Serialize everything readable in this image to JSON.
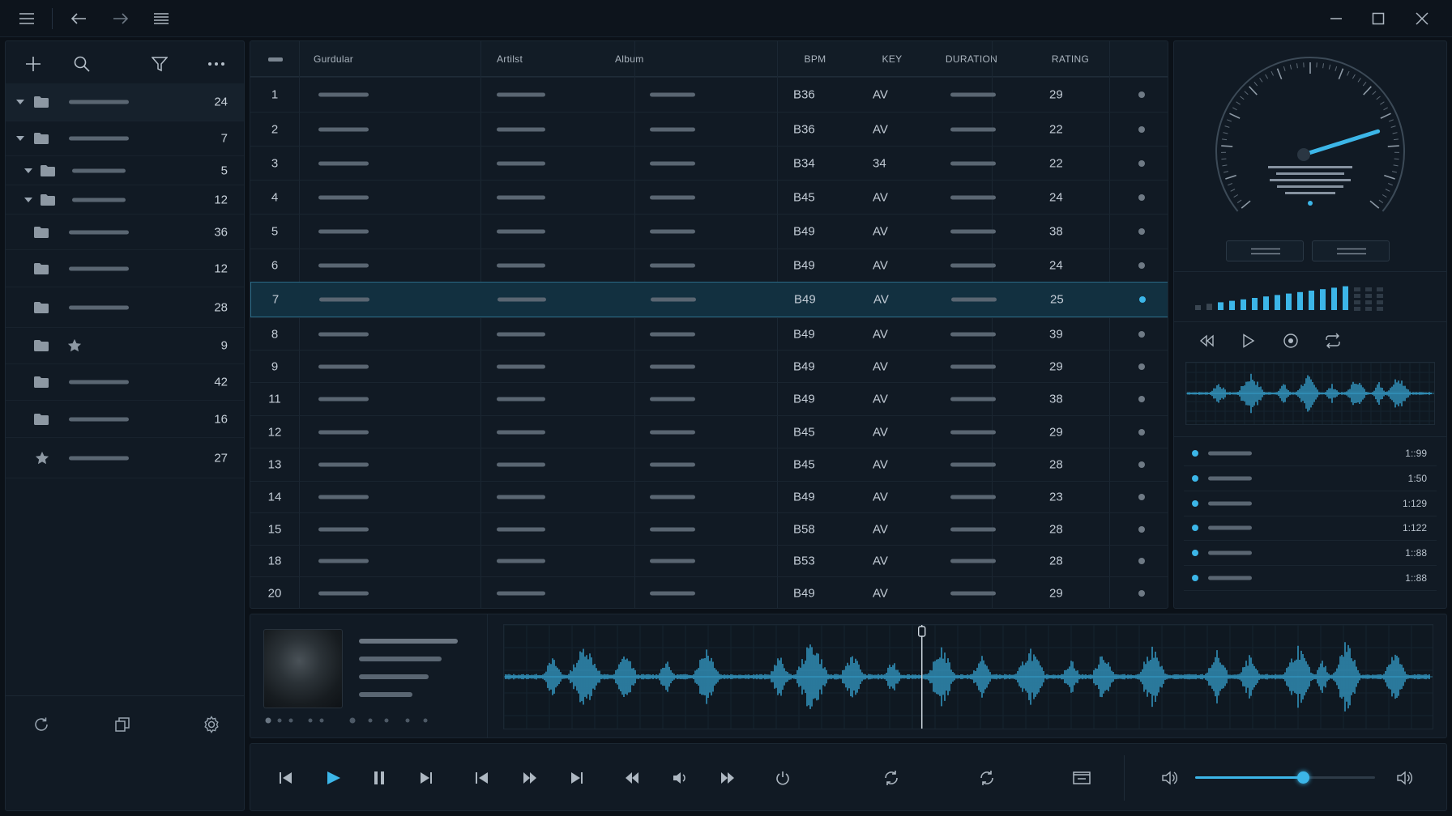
{
  "titlebar": {
    "icons": [
      "hamburger-icon",
      "back-arrow-icon",
      "forward-arrow-icon",
      "list-icon",
      "minimize-icon",
      "maximize-icon",
      "close-icon"
    ]
  },
  "sidebar": {
    "tools": [
      "add-icon",
      "search-icon",
      "filter-icon",
      "more-icon"
    ],
    "tree": [
      {
        "count": "24",
        "expanded": true,
        "level": 0,
        "kind": "folder"
      },
      {
        "count": "7",
        "expanded": true,
        "level": 0,
        "kind": "folder"
      },
      {
        "count": "5",
        "expanded": true,
        "level": 1,
        "kind": "folder"
      },
      {
        "count": "12",
        "expanded": true,
        "level": 1,
        "kind": "folder"
      },
      {
        "count": "36",
        "level": 2,
        "kind": "folder"
      },
      {
        "count": "12",
        "level": 2,
        "kind": "folder"
      },
      {
        "count": "28",
        "level": 2,
        "kind": "folder"
      },
      {
        "count": "9",
        "level": 2,
        "kind": "folder-star"
      },
      {
        "count": "42",
        "level": 2,
        "kind": "folder"
      },
      {
        "count": "16",
        "level": 2,
        "kind": "folder"
      },
      {
        "count": "27",
        "level": 2,
        "kind": "star"
      }
    ],
    "footer_icons": [
      "refresh-icon",
      "copy-icon",
      "settings-icon"
    ]
  },
  "table": {
    "columns": [
      "Gurdular",
      "Artilst",
      "Album",
      "BPM",
      "KEY",
      "DURATION",
      "RATING"
    ],
    "rows": [
      {
        "num": "1",
        "bpm": "B36",
        "key": "AV",
        "rating": "29"
      },
      {
        "num": "2",
        "bpm": "B36",
        "key": "AV",
        "rating": "22"
      },
      {
        "num": "3",
        "bpm": "B34",
        "key": "34",
        "rating": "22"
      },
      {
        "num": "4",
        "bpm": "B45",
        "key": "AV",
        "rating": "24"
      },
      {
        "num": "5",
        "bpm": "B49",
        "key": "AV",
        "rating": "38"
      },
      {
        "num": "6",
        "bpm": "B49",
        "key": "AV",
        "rating": "24"
      },
      {
        "num": "7",
        "bpm": "B49",
        "key": "AV",
        "rating": "25",
        "selected": true
      },
      {
        "num": "8",
        "bpm": "B49",
        "key": "AV",
        "rating": "39"
      },
      {
        "num": "9",
        "bpm": "B49",
        "key": "AV",
        "rating": "29"
      },
      {
        "num": "11",
        "bpm": "B49",
        "key": "AV",
        "rating": "38"
      },
      {
        "num": "12",
        "bpm": "B45",
        "key": "AV",
        "rating": "29"
      },
      {
        "num": "13",
        "bpm": "B45",
        "key": "AV",
        "rating": "28"
      },
      {
        "num": "14",
        "bpm": "B49",
        "key": "AV",
        "rating": "23"
      },
      {
        "num": "15",
        "bpm": "B58",
        "key": "AV",
        "rating": "28"
      },
      {
        "num": "18",
        "bpm": "B53",
        "key": "AV",
        "rating": "28"
      },
      {
        "num": "20",
        "bpm": "B49",
        "key": "AV",
        "rating": "29"
      }
    ]
  },
  "right_panel": {
    "gauge_level": 0.78,
    "level_meter_active": 14,
    "level_meter_total": 17,
    "transport_icons": [
      "rewind-icon",
      "play-icon",
      "record-icon",
      "loop-icon"
    ],
    "queue": [
      {
        "time": "1::99"
      },
      {
        "time": "1:50"
      },
      {
        "time": "1:129"
      },
      {
        "time": "1:122"
      },
      {
        "time": "1::88"
      },
      {
        "time": "1::88"
      }
    ]
  },
  "now_playing": {
    "playhead_position": 0.45,
    "carousel_dots": 11
  },
  "player": {
    "icons": [
      "skip-start-icon",
      "play-icon",
      "pause-icon",
      "skip-end-icon",
      "previous-icon",
      "fast-forward-icon",
      "next-icon",
      "rewind-icon",
      "volume-icon",
      "forward-icon",
      "power-icon",
      "repeat-icon",
      "shuffle-repeat-icon",
      "screen-icon",
      "volume-low-icon",
      "volume-high-icon"
    ],
    "volume": 0.6
  },
  "colors": {
    "accent": "#3cb6e8",
    "background": "#0b1118",
    "panel": "#111a24"
  }
}
